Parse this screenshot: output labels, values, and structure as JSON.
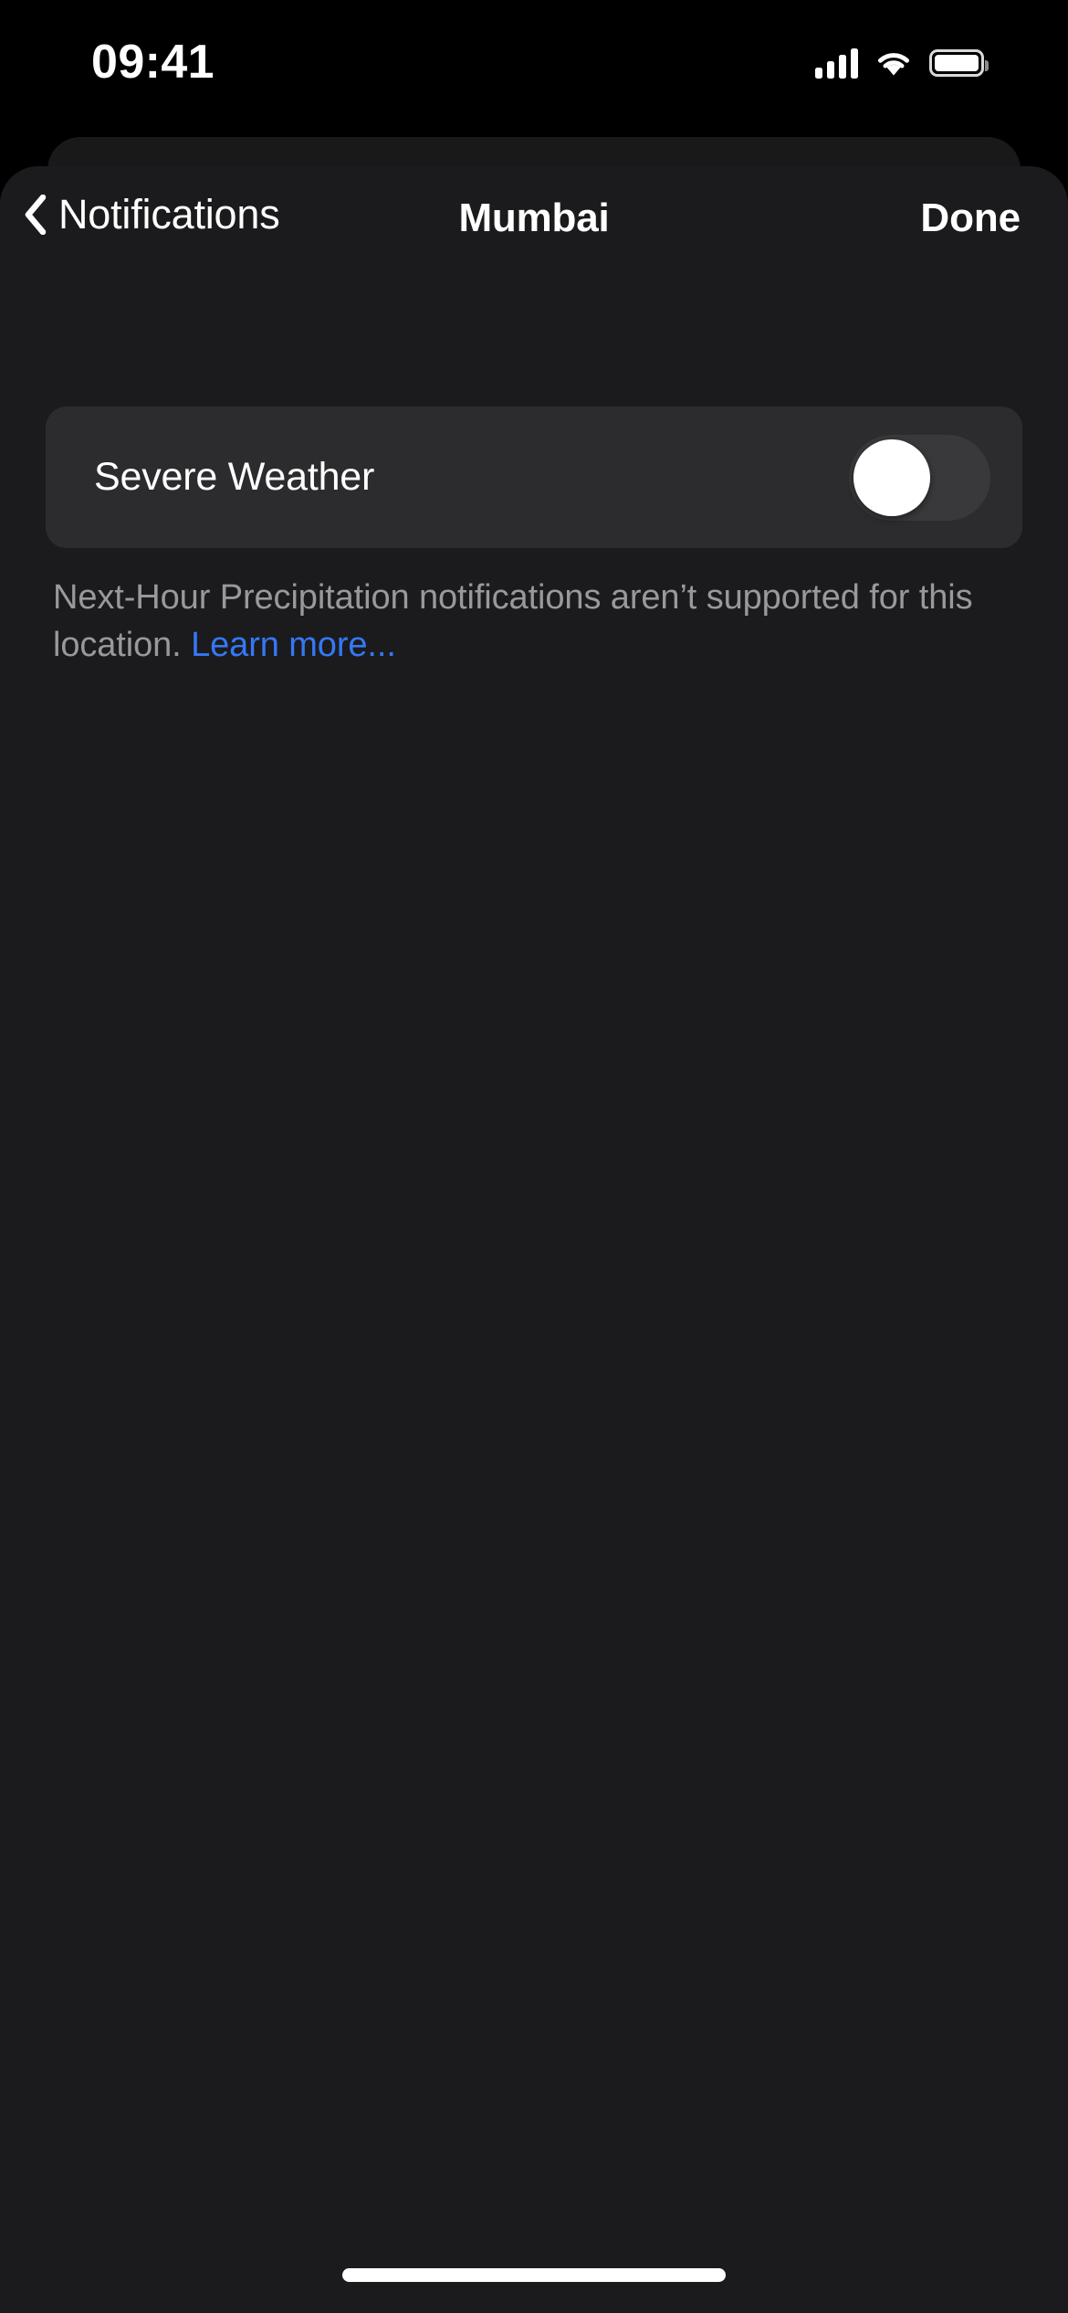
{
  "status_bar": {
    "time": "09:41",
    "cellular_icon": "cellular-bars-icon",
    "wifi_icon": "wifi-icon",
    "battery_icon": "battery-icon"
  },
  "nav_bar": {
    "back_icon": "chevron-left-icon",
    "back_label": "Notifications",
    "title": "Mumbai",
    "done_label": "Done"
  },
  "settings": {
    "rows": [
      {
        "label": "Severe Weather",
        "toggle_state": "off",
        "toggle_name": "severe-weather-toggle"
      }
    ]
  },
  "footer": {
    "text_before": "Next-Hour Precipitation notifications aren’t supported for this location. ",
    "link_label": "Learn more..."
  },
  "colors": {
    "page_background": "#1b1b1d",
    "status_bar_background": "#000000",
    "card_background": "#2c2c2e",
    "toggle_track_off": "#39393c",
    "toggle_knob": "#ffffff",
    "primary_text": "#ffffff",
    "secondary_text": "#98989d",
    "link_blue": "#3478f6",
    "home_indicator": "#ffffff"
  },
  "home_indicator": {
    "name": "home-indicator"
  }
}
